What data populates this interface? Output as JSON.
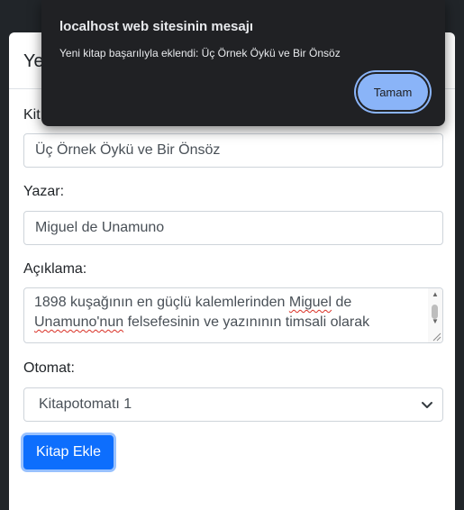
{
  "modal": {
    "title": "Yeni Kitap Ekle",
    "title_visible": "Ye",
    "fields": {
      "kitap_label": "Kitap Adı:",
      "kitap_label_visible": "Kit",
      "kitap_value": "Üç Örnek Öykü ve Bir Önsöz",
      "yazar_label": "Yazar:",
      "yazar_value": "Miguel de Unamuno",
      "aciklama_label": "Açıklama:",
      "aciklama_line1_a": "1898 kuşağının en güçlü kalemlerinden ",
      "aciklama_line1_b": "Miguel",
      "aciklama_line1_c": " de",
      "aciklama_line2_a": "Unamuno'nun",
      "aciklama_line2_b": " felsefesinin ve yazınının timsali olarak",
      "otomat_label": "Otomat:",
      "otomat_value": "Kitapotomatı 1"
    },
    "submit_label": "Kitap Ekle",
    "accent": "#0d6efd"
  },
  "alert": {
    "title": "localhost web sitesinin mesajı",
    "message": "Yeni kitap başarılıyla eklendi: Üç Örnek Öykü ve Bir Önsöz",
    "ok_label": "Tamam",
    "accent": "#8ab4f8"
  }
}
